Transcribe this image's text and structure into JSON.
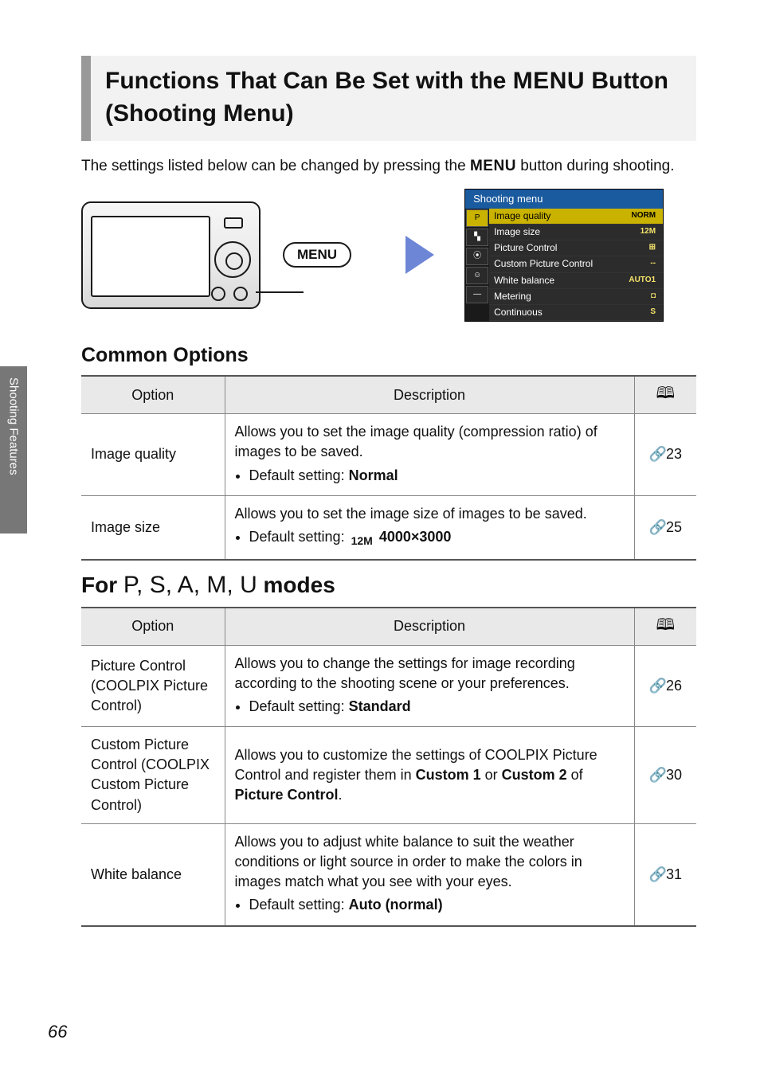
{
  "sidetab": "Shooting Features",
  "pagenum": "66",
  "title_pre": "Functions That Can Be Set with the ",
  "title_menu": "MENU",
  "title_post": " Button (Shooting Menu)",
  "intro_pre": "The settings listed below can be changed by pressing the ",
  "intro_menu": "MENU",
  "intro_post": " button during shooting.",
  "menu_pill": "MENU",
  "shooting_menu": {
    "title": "Shooting menu",
    "tabs": [
      "P",
      "▚",
      "⦿",
      "☺",
      "—"
    ],
    "rows": [
      {
        "label": "Image quality",
        "val": "NORM",
        "sel": true
      },
      {
        "label": "Image size",
        "val": "12M"
      },
      {
        "label": "Picture Control",
        "val": "⊞"
      },
      {
        "label": "Custom Picture Control",
        "val": "--"
      },
      {
        "label": "White balance",
        "val": "AUTO1"
      },
      {
        "label": "Metering",
        "val": "◘"
      },
      {
        "label": "Continuous",
        "val": "S"
      }
    ]
  },
  "sect1": "Common Options",
  "th_option": "Option",
  "th_desc": "Description",
  "book_icon": "📖",
  "ref_icon": "🔗",
  "common_rows": [
    {
      "opt": "Image quality",
      "desc": "Allows you to set the image quality (compression ratio) of images to be saved.",
      "ds_label": "Default setting: ",
      "ds": "Normal",
      "pg": "23"
    },
    {
      "opt": "Image size",
      "desc": "Allows you to set the image size of images to be saved.",
      "ds_label": "Default setting: ",
      "ds_icon": "12M",
      "ds": "4000×3000",
      "pg": "25"
    }
  ],
  "sect2_pre": "For ",
  "sect2_modes": "P, S, A, M, U",
  "sect2_post": " modes",
  "mode_rows": [
    {
      "opt": "Picture Control (COOLPIX Picture Control)",
      "desc": "Allows you to change the settings for image recording according to the shooting scene or your preferences.",
      "ds_label": "Default setting: ",
      "ds": "Standard",
      "pg": "26"
    },
    {
      "opt": "Custom Picture Control (COOLPIX Custom Picture Control)",
      "desc_pre": "Allows you to customize the settings of COOLPIX Picture Control and register them in ",
      "b1": "Custom 1",
      "mid": " or ",
      "b2": "Custom 2",
      "mid2": " of ",
      "b3": "Picture Control",
      "tail": ".",
      "pg": "30"
    },
    {
      "opt": "White balance",
      "desc": "Allows you to adjust white balance to suit the weather conditions or light source in order to make the colors in images match what you see with your eyes.",
      "ds_label": "Default setting: ",
      "ds": "Auto (normal)",
      "pg": "31"
    }
  ]
}
